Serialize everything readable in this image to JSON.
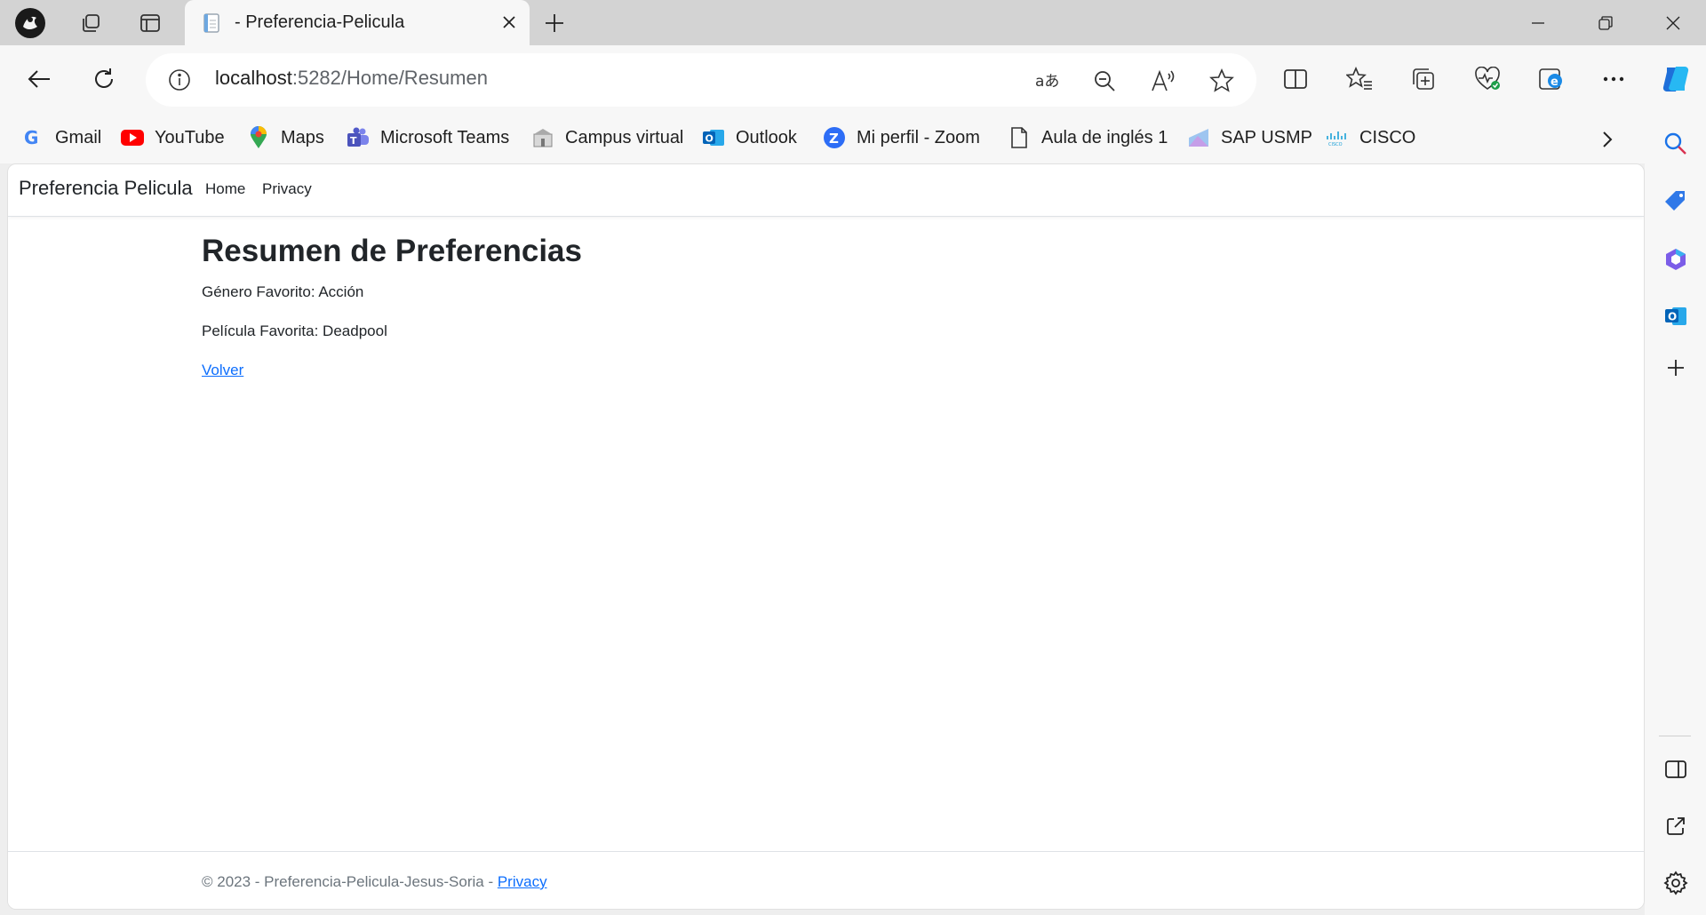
{
  "browser": {
    "tab": {
      "title": "- Preferencia-Pelicula"
    },
    "address": {
      "host": "localhost",
      "path": ":5282/Home/Resumen"
    },
    "favorites": [
      {
        "label": "Gmail",
        "icon": "google-icon"
      },
      {
        "label": "YouTube",
        "icon": "youtube-icon"
      },
      {
        "label": "Maps",
        "icon": "maps-pin-icon"
      },
      {
        "label": "Microsoft Teams",
        "icon": "teams-icon"
      },
      {
        "label": "Campus virtual",
        "icon": "campus-icon"
      },
      {
        "label": "Outlook",
        "icon": "outlook-icon"
      },
      {
        "label": "Mi perfil - Zoom",
        "icon": "zoom-icon"
      },
      {
        "label": "Aula de inglés 1",
        "icon": "document-icon"
      },
      {
        "label": "SAP USMP",
        "icon": "sap-icon"
      },
      {
        "label": "CISCO",
        "icon": "cisco-icon"
      }
    ],
    "colors": {
      "chrome": "#d3d3d3",
      "toolbar": "#f7f7f7",
      "accent": "#0d6efd"
    }
  },
  "site": {
    "brand": "Preferencia Pelicula",
    "nav": [
      "Home",
      "Privacy"
    ],
    "heading": "Resumen de Preferencias",
    "genre_line": "Género Favorito: Acción",
    "movie_line": "Película Favorita: Deadpool",
    "back_link": "Volver",
    "footer": {
      "text": "© 2023 - Preferencia-Pelicula-Jesus-Soria -",
      "link": "Privacy"
    }
  }
}
